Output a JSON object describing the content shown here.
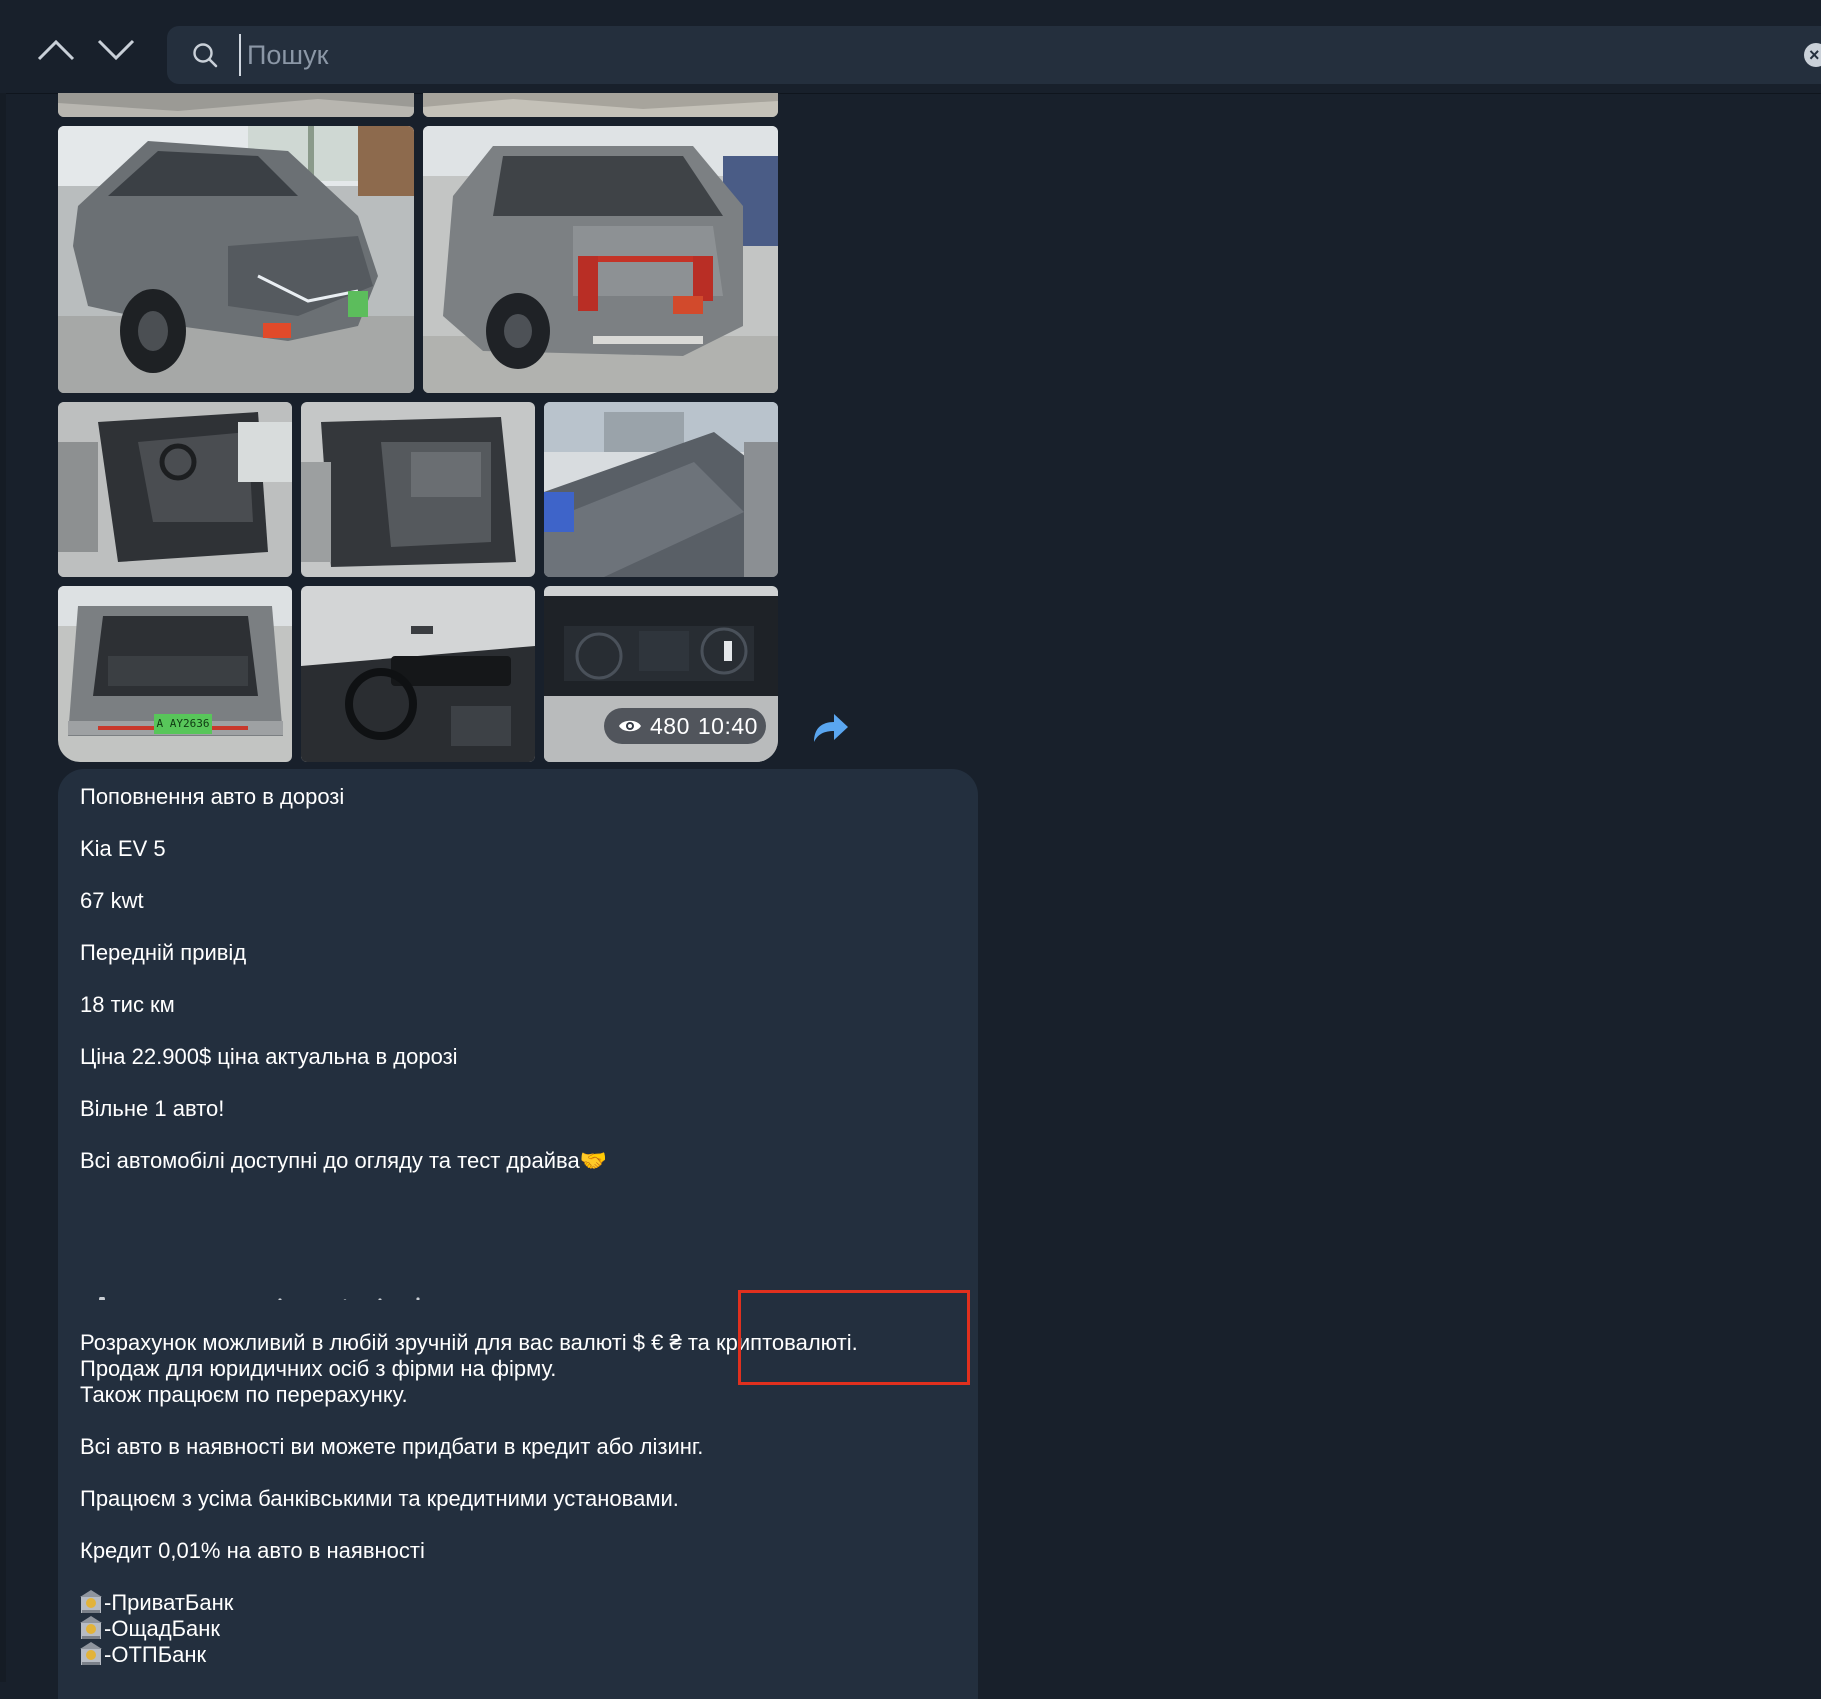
{
  "toolbar": {
    "up_icon": "chevron-up-icon",
    "down_icon": "chevron-down-icon"
  },
  "search": {
    "placeholder": "Пошук",
    "value": "",
    "icon": "search-icon",
    "clear_icon": "clear-icon"
  },
  "album": {
    "views": "480",
    "time": "10:40",
    "views_icon": "eye-icon",
    "forward_icon": "forward-arrow-icon",
    "license_plate": "A AY2636"
  },
  "message": {
    "lines": [
      "Поповнення авто в дорозі",
      "Kia EV 5",
      "67  kwt",
      "Передній привід",
      "18 тис км",
      "Ціна 22.900$ ціна актуальна в дорозі",
      "Вільне 1 авто!",
      "Всі автомобілі доступні до огляду та тест драйва🤝",
      "Розрахунок можливий в любій зручній для вас валюті $ € ₴ та криптовалюті.",
      "Продаж для юридичних осіб з фірми на фірму.",
      "Також працюєм по перерахунку.",
      "Всі авто в наявності ви можете придбати в кредит або лізинг.",
      "Працюєм з усіма банківськими та кредитними установами.",
      "Кредит 0,01% на авто в наявності"
    ],
    "banks": [
      "-ПриватБанк",
      "-ОщадБанк",
      "-ОТПБанк"
    ]
  },
  "colors": {
    "background": "#18202b",
    "bubble": "#232f3e",
    "search_bg": "#242f3d",
    "accent": "#5aa6f0",
    "highlight": "#e0301e"
  }
}
